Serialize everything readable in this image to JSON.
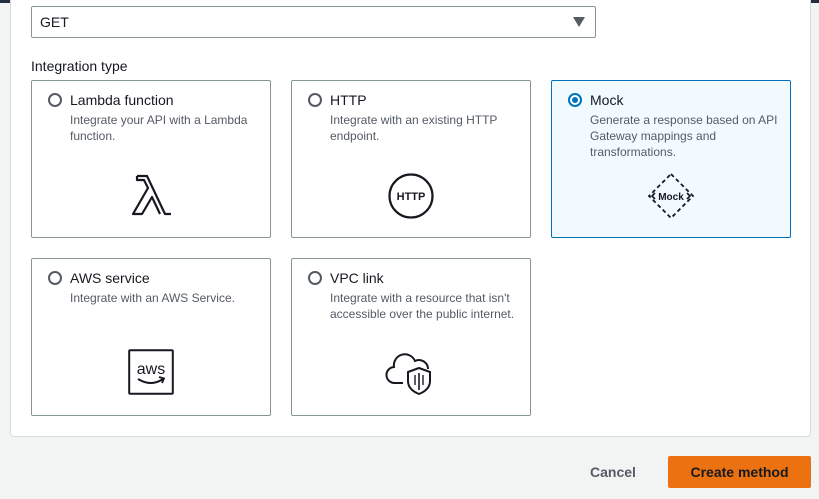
{
  "method_select": {
    "value": "GET"
  },
  "integration": {
    "label": "Integration type",
    "options": [
      {
        "title": "Lambda function",
        "description": "Integrate your API with a Lambda function.",
        "icon": "lambda-icon",
        "selected": false
      },
      {
        "title": "HTTP",
        "description": "Integrate with an existing HTTP endpoint.",
        "icon": "http-icon",
        "icon_text": "HTTP",
        "selected": false
      },
      {
        "title": "Mock",
        "description": "Generate a response based on API Gateway mappings and transformations.",
        "icon": "mock-icon",
        "icon_text": "Mock",
        "selected": true
      },
      {
        "title": "AWS service",
        "description": "Integrate with an AWS Service.",
        "icon": "aws-icon",
        "icon_text": "aws",
        "selected": false
      },
      {
        "title": "VPC link",
        "description": "Integrate with a resource that isn't accessible over the public internet.",
        "icon": "vpc-cloud-shield-icon",
        "selected": false
      }
    ]
  },
  "footer": {
    "cancel_label": "Cancel",
    "create_label": "Create method"
  },
  "colors": {
    "accent": "#0073bb",
    "primary_button": "#ec7211",
    "selected_bg": "#f1faff"
  }
}
